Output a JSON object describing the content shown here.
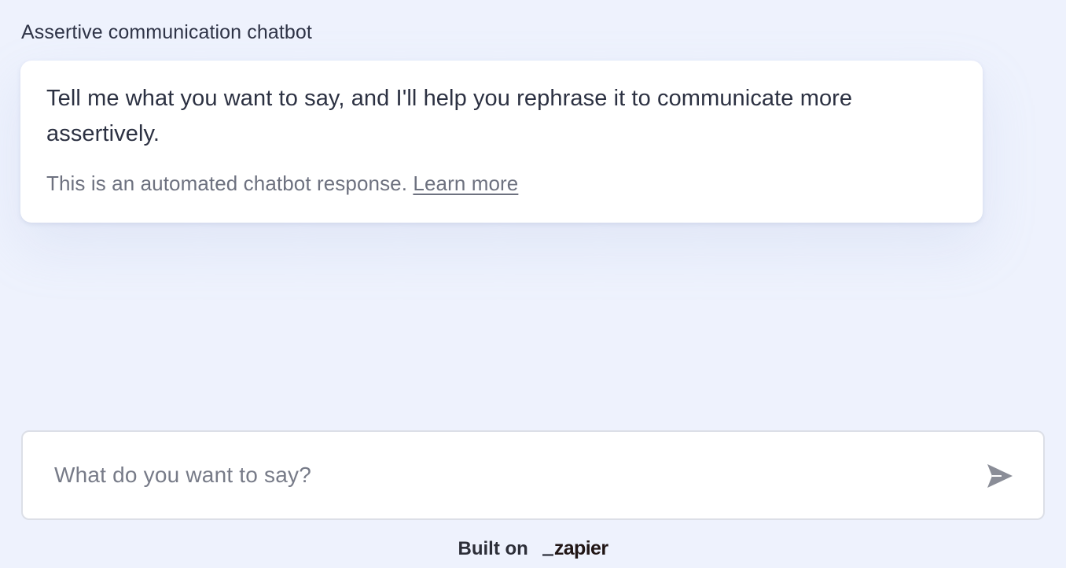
{
  "header": {
    "title": "Assertive communication chatbot"
  },
  "messages": [
    {
      "role": "bot",
      "text": "Tell me what you want to say, and I'll help you rephrase it to communicate more assertively.",
      "disclaimer": "This is an automated chatbot response.",
      "link_label": "Learn more"
    }
  ],
  "composer": {
    "placeholder": "What do you want to say?",
    "value": "",
    "send_icon": "send-icon"
  },
  "footer": {
    "built_on": "Built on",
    "brand": "zapier"
  },
  "colors": {
    "background": "#eef2fd",
    "card": "#ffffff",
    "send_icon": "#8a8d97"
  }
}
